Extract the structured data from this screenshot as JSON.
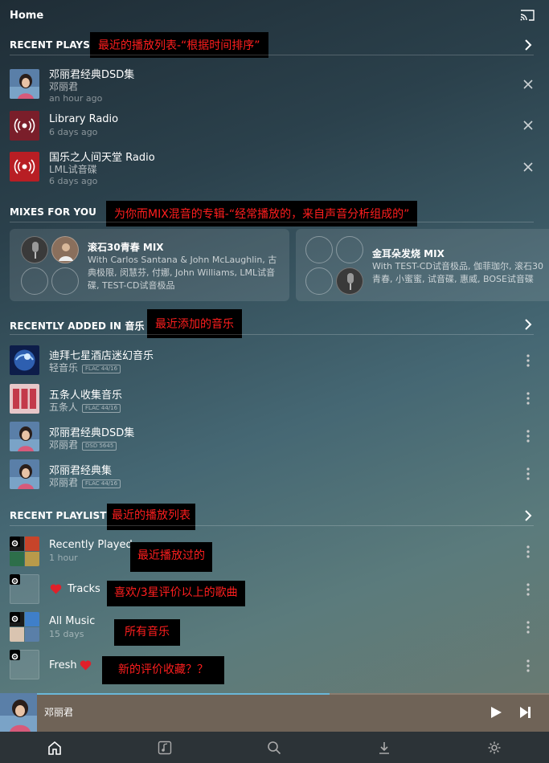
{
  "header": {
    "title": "Home",
    "cast_icon": "cast-icon"
  },
  "recent_plays": {
    "heading": "RECENT PLAYS",
    "annotation": "最近的播放列表-“根据时间排序”",
    "items": [
      {
        "title": "邓丽君经典DSD集",
        "artist": "邓丽君",
        "time": "an hour ago"
      },
      {
        "title": "Library Radio",
        "artist": "",
        "time": "6 days ago"
      },
      {
        "title": "国乐之人间天堂 Radio",
        "artist": "LML试音碟",
        "time": "6 days ago"
      }
    ]
  },
  "mixes": {
    "heading": "MIXES FOR YOU",
    "annotation": "为你而MIX混音的专辑-“经常播放的，来自声音分析组成的”",
    "cards": [
      {
        "title": "滚石30青春 MIX",
        "desc": "With Carlos Santana & John McLaughlin, 古典极限, 闵慧芬, 付娜, John Williams, LML试音碟, TEST-CD试音极品"
      },
      {
        "title": "金耳朵发烧 MIX",
        "desc": "With TEST-CD试音极品, 伽菲珈尔, 滚石30青春, 小蜜蜜, 试音碟, 惠威, BOSE试音碟"
      }
    ]
  },
  "recently_added": {
    "heading": "RECENTLY ADDED IN 音乐",
    "annotation": "最近添加的音乐",
    "items": [
      {
        "title": "迪拜七星酒店迷幻音乐",
        "artist": "轻音乐",
        "format": "FLAC 44/16"
      },
      {
        "title": "五条人收集音乐",
        "artist": "五条人",
        "format": "FLAC 44/16"
      },
      {
        "title": "邓丽君经典DSD集",
        "artist": "邓丽君",
        "format": "DSD 5645"
      },
      {
        "title": "邓丽君经典集",
        "artist": "邓丽君",
        "format": "FLAC 44/16"
      }
    ]
  },
  "playlists": {
    "heading": "RECENT PLAYLISTS",
    "annotation": "最近的播放列表",
    "items": [
      {
        "title": "Recently Played",
        "sub": "1 hour",
        "annotation": "最近播放过的"
      },
      {
        "title": "Tracks",
        "sub": "",
        "annotation": "喜欢/3星评价以上的歌曲"
      },
      {
        "title": "All Music",
        "sub": "15 days",
        "annotation": "所有音乐"
      },
      {
        "title": "Fresh",
        "sub": "",
        "annotation": "新的评价收藏？？"
      }
    ]
  },
  "player": {
    "artist": "邓丽君",
    "progress": 0.6
  },
  "colors": {
    "accent": "#6ab7d8",
    "annotation_text": "#ff1e1e",
    "heart": "#e0202a"
  }
}
